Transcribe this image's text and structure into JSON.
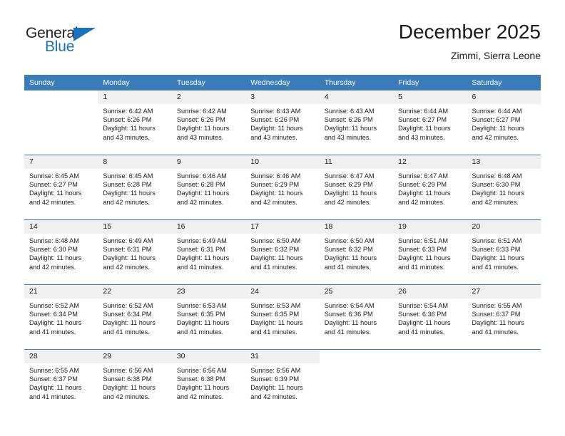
{
  "logo": {
    "word_one": "General",
    "word_two": "Blue",
    "triangle_icon": "triangle-icon",
    "brand_blue": "#1673bd",
    "brand_dark": "#231f20"
  },
  "header": {
    "title": "December 2025",
    "subtitle": "Zimmi, Sierra Leone"
  },
  "theme": {
    "header_blue": "#3a7cb9",
    "daynum_gray": "#f0f0f0",
    "text": "#1a1a1a"
  },
  "weekday_headers": [
    "Sunday",
    "Monday",
    "Tuesday",
    "Wednesday",
    "Thursday",
    "Friday",
    "Saturday"
  ],
  "weeks": [
    {
      "days": [
        {
          "num": "",
          "empty": true,
          "sunrise": "",
          "sunset": "",
          "daylight_line1": "",
          "daylight_line2": ""
        },
        {
          "num": "1",
          "empty": false,
          "sunrise": "Sunrise: 6:42 AM",
          "sunset": "Sunset: 6:26 PM",
          "daylight_line1": "Daylight: 11 hours",
          "daylight_line2": "and 43 minutes."
        },
        {
          "num": "2",
          "empty": false,
          "sunrise": "Sunrise: 6:42 AM",
          "sunset": "Sunset: 6:26 PM",
          "daylight_line1": "Daylight: 11 hours",
          "daylight_line2": "and 43 minutes."
        },
        {
          "num": "3",
          "empty": false,
          "sunrise": "Sunrise: 6:43 AM",
          "sunset": "Sunset: 6:26 PM",
          "daylight_line1": "Daylight: 11 hours",
          "daylight_line2": "and 43 minutes."
        },
        {
          "num": "4",
          "empty": false,
          "sunrise": "Sunrise: 6:43 AM",
          "sunset": "Sunset: 6:26 PM",
          "daylight_line1": "Daylight: 11 hours",
          "daylight_line2": "and 43 minutes."
        },
        {
          "num": "5",
          "empty": false,
          "sunrise": "Sunrise: 6:44 AM",
          "sunset": "Sunset: 6:27 PM",
          "daylight_line1": "Daylight: 11 hours",
          "daylight_line2": "and 43 minutes."
        },
        {
          "num": "6",
          "empty": false,
          "sunrise": "Sunrise: 6:44 AM",
          "sunset": "Sunset: 6:27 PM",
          "daylight_line1": "Daylight: 11 hours",
          "daylight_line2": "and 42 minutes."
        }
      ]
    },
    {
      "days": [
        {
          "num": "7",
          "empty": false,
          "sunrise": "Sunrise: 6:45 AM",
          "sunset": "Sunset: 6:27 PM",
          "daylight_line1": "Daylight: 11 hours",
          "daylight_line2": "and 42 minutes."
        },
        {
          "num": "8",
          "empty": false,
          "sunrise": "Sunrise: 6:45 AM",
          "sunset": "Sunset: 6:28 PM",
          "daylight_line1": "Daylight: 11 hours",
          "daylight_line2": "and 42 minutes."
        },
        {
          "num": "9",
          "empty": false,
          "sunrise": "Sunrise: 6:46 AM",
          "sunset": "Sunset: 6:28 PM",
          "daylight_line1": "Daylight: 11 hours",
          "daylight_line2": "and 42 minutes."
        },
        {
          "num": "10",
          "empty": false,
          "sunrise": "Sunrise: 6:46 AM",
          "sunset": "Sunset: 6:29 PM",
          "daylight_line1": "Daylight: 11 hours",
          "daylight_line2": "and 42 minutes."
        },
        {
          "num": "11",
          "empty": false,
          "sunrise": "Sunrise: 6:47 AM",
          "sunset": "Sunset: 6:29 PM",
          "daylight_line1": "Daylight: 11 hours",
          "daylight_line2": "and 42 minutes."
        },
        {
          "num": "12",
          "empty": false,
          "sunrise": "Sunrise: 6:47 AM",
          "sunset": "Sunset: 6:29 PM",
          "daylight_line1": "Daylight: 11 hours",
          "daylight_line2": "and 42 minutes."
        },
        {
          "num": "13",
          "empty": false,
          "sunrise": "Sunrise: 6:48 AM",
          "sunset": "Sunset: 6:30 PM",
          "daylight_line1": "Daylight: 11 hours",
          "daylight_line2": "and 42 minutes."
        }
      ]
    },
    {
      "days": [
        {
          "num": "14",
          "empty": false,
          "sunrise": "Sunrise: 6:48 AM",
          "sunset": "Sunset: 6:30 PM",
          "daylight_line1": "Daylight: 11 hours",
          "daylight_line2": "and 42 minutes."
        },
        {
          "num": "15",
          "empty": false,
          "sunrise": "Sunrise: 6:49 AM",
          "sunset": "Sunset: 6:31 PM",
          "daylight_line1": "Daylight: 11 hours",
          "daylight_line2": "and 42 minutes."
        },
        {
          "num": "16",
          "empty": false,
          "sunrise": "Sunrise: 6:49 AM",
          "sunset": "Sunset: 6:31 PM",
          "daylight_line1": "Daylight: 11 hours",
          "daylight_line2": "and 41 minutes."
        },
        {
          "num": "17",
          "empty": false,
          "sunrise": "Sunrise: 6:50 AM",
          "sunset": "Sunset: 6:32 PM",
          "daylight_line1": "Daylight: 11 hours",
          "daylight_line2": "and 41 minutes."
        },
        {
          "num": "18",
          "empty": false,
          "sunrise": "Sunrise: 6:50 AM",
          "sunset": "Sunset: 6:32 PM",
          "daylight_line1": "Daylight: 11 hours",
          "daylight_line2": "and 41 minutes."
        },
        {
          "num": "19",
          "empty": false,
          "sunrise": "Sunrise: 6:51 AM",
          "sunset": "Sunset: 6:33 PM",
          "daylight_line1": "Daylight: 11 hours",
          "daylight_line2": "and 41 minutes."
        },
        {
          "num": "20",
          "empty": false,
          "sunrise": "Sunrise: 6:51 AM",
          "sunset": "Sunset: 6:33 PM",
          "daylight_line1": "Daylight: 11 hours",
          "daylight_line2": "and 41 minutes."
        }
      ]
    },
    {
      "days": [
        {
          "num": "21",
          "empty": false,
          "sunrise": "Sunrise: 6:52 AM",
          "sunset": "Sunset: 6:34 PM",
          "daylight_line1": "Daylight: 11 hours",
          "daylight_line2": "and 41 minutes."
        },
        {
          "num": "22",
          "empty": false,
          "sunrise": "Sunrise: 6:52 AM",
          "sunset": "Sunset: 6:34 PM",
          "daylight_line1": "Daylight: 11 hours",
          "daylight_line2": "and 41 minutes."
        },
        {
          "num": "23",
          "empty": false,
          "sunrise": "Sunrise: 6:53 AM",
          "sunset": "Sunset: 6:35 PM",
          "daylight_line1": "Daylight: 11 hours",
          "daylight_line2": "and 41 minutes."
        },
        {
          "num": "24",
          "empty": false,
          "sunrise": "Sunrise: 6:53 AM",
          "sunset": "Sunset: 6:35 PM",
          "daylight_line1": "Daylight: 11 hours",
          "daylight_line2": "and 41 minutes."
        },
        {
          "num": "25",
          "empty": false,
          "sunrise": "Sunrise: 6:54 AM",
          "sunset": "Sunset: 6:36 PM",
          "daylight_line1": "Daylight: 11 hours",
          "daylight_line2": "and 41 minutes."
        },
        {
          "num": "26",
          "empty": false,
          "sunrise": "Sunrise: 6:54 AM",
          "sunset": "Sunset: 6:36 PM",
          "daylight_line1": "Daylight: 11 hours",
          "daylight_line2": "and 41 minutes."
        },
        {
          "num": "27",
          "empty": false,
          "sunrise": "Sunrise: 6:55 AM",
          "sunset": "Sunset: 6:37 PM",
          "daylight_line1": "Daylight: 11 hours",
          "daylight_line2": "and 41 minutes."
        }
      ]
    },
    {
      "days": [
        {
          "num": "28",
          "empty": false,
          "sunrise": "Sunrise: 6:55 AM",
          "sunset": "Sunset: 6:37 PM",
          "daylight_line1": "Daylight: 11 hours",
          "daylight_line2": "and 41 minutes."
        },
        {
          "num": "29",
          "empty": false,
          "sunrise": "Sunrise: 6:56 AM",
          "sunset": "Sunset: 6:38 PM",
          "daylight_line1": "Daylight: 11 hours",
          "daylight_line2": "and 42 minutes."
        },
        {
          "num": "30",
          "empty": false,
          "sunrise": "Sunrise: 6:56 AM",
          "sunset": "Sunset: 6:38 PM",
          "daylight_line1": "Daylight: 11 hours",
          "daylight_line2": "and 42 minutes."
        },
        {
          "num": "31",
          "empty": false,
          "sunrise": "Sunrise: 6:56 AM",
          "sunset": "Sunset: 6:39 PM",
          "daylight_line1": "Daylight: 11 hours",
          "daylight_line2": "and 42 minutes."
        },
        {
          "num": "",
          "empty": true,
          "sunrise": "",
          "sunset": "",
          "daylight_line1": "",
          "daylight_line2": ""
        },
        {
          "num": "",
          "empty": true,
          "sunrise": "",
          "sunset": "",
          "daylight_line1": "",
          "daylight_line2": ""
        },
        {
          "num": "",
          "empty": true,
          "sunrise": "",
          "sunset": "",
          "daylight_line1": "",
          "daylight_line2": ""
        }
      ]
    }
  ]
}
